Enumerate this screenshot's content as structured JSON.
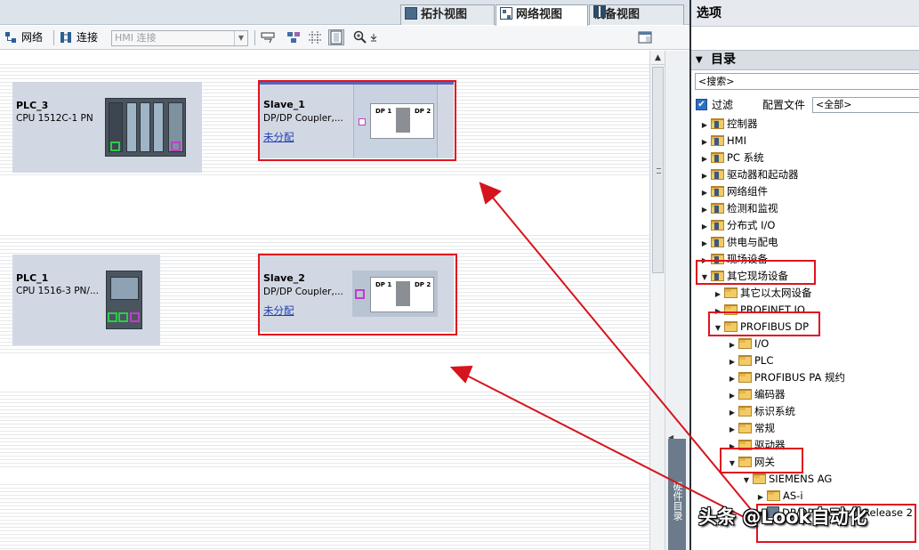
{
  "view_tabs": [
    "拓扑视图",
    "网络视图",
    "设备视图"
  ],
  "toolbar": {
    "network": "网络",
    "connection": "连接",
    "hmi_select": "HMI 连接"
  },
  "devices": {
    "plc3": {
      "name": "PLC_3",
      "type": "CPU 1512C-1 PN"
    },
    "plc1": {
      "name": "PLC_1",
      "type": "CPU 1516-3 PN/..."
    },
    "slave1": {
      "name": "Slave_1",
      "type": "DP/DP Coupler,...",
      "status": "未分配",
      "port1": "DP 1",
      "port2": "DP 2"
    },
    "slave2": {
      "name": "Slave_2",
      "type": "DP/DP Coupler,...",
      "status": "未分配",
      "port1": "DP 1",
      "port2": "DP 2"
    }
  },
  "side_tab": "硬件目录",
  "catalog": {
    "options_title": "选项",
    "title": "目录",
    "search_placeholder": "<搜索>",
    "filter_label": "过滤",
    "profile_label": "配置文件",
    "profile_value": "<全部>",
    "items": [
      "控制器",
      "HMI",
      "PC 系统",
      "驱动器和起动器",
      "网络组件",
      "检测和监视",
      "分布式 I/O",
      "供电与配电",
      "现场设备",
      "其它现场设备",
      "其它以太网设备",
      "PROFINET IO",
      "PROFIBUS DP",
      "I/O",
      "PLC",
      "PROFIBUS PA 规约",
      "编码器",
      "标识系统",
      "常规",
      "驱动器",
      "网关",
      "SIEMENS AG",
      "AS-i",
      "DP/DP Coupler, Release 2"
    ]
  },
  "watermark": "头条 @Look自动化"
}
